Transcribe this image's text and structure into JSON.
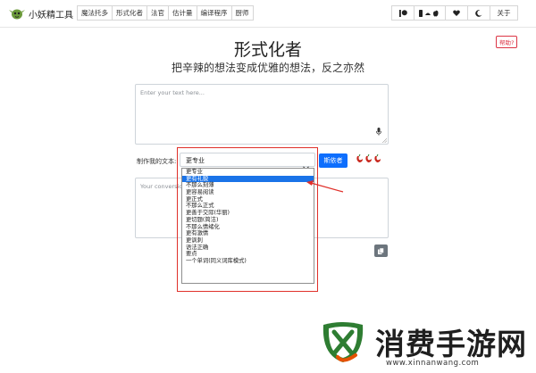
{
  "navbar": {
    "brand": "小妖精工具",
    "links": [
      "魔法托多",
      "形式化者",
      "法官",
      "估计量",
      "编译程序",
      "厨师"
    ],
    "about": "关于"
  },
  "help_label": "帮助?",
  "title": "形式化者",
  "subtitle": "把辛辣的想法变成优雅的想法，反之亦然",
  "input": {
    "placeholder": "Enter your text here..."
  },
  "controls": {
    "label": "制作我的文本:",
    "selected": "更专业",
    "button": "斯依者"
  },
  "output": {
    "placeholder": "Your conversion"
  },
  "dropdown": {
    "options": [
      "更专业",
      "更有礼貌",
      "不那么刻薄",
      "更容易阅读",
      "更正式",
      "不那么正式",
      "更善于交际(华丽)",
      "更切题(简洁)",
      "不那么情绪化",
      "更有激情",
      "更讽刺",
      "语法正确",
      "要点",
      "一个单词(同义词库模式)"
    ],
    "highlighted": "更有礼貌"
  },
  "watermark": {
    "text": "消费手游网",
    "url": "www.xinnanwang.com"
  },
  "colors": {
    "accent": "#0d6efd",
    "annotation": "#e0302a",
    "danger": "#dc3545"
  }
}
